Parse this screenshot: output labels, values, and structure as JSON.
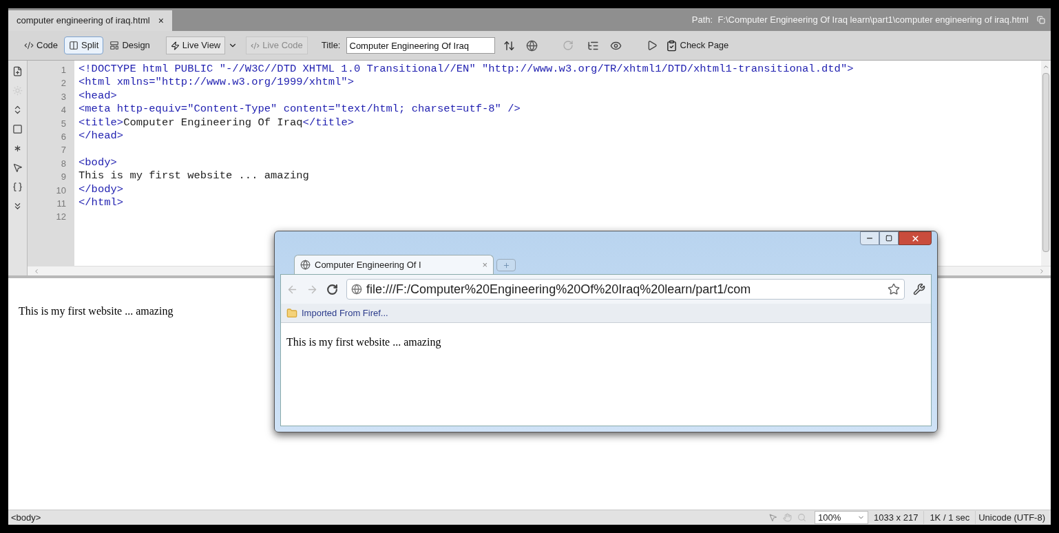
{
  "document_tab": {
    "label": "computer engineering of iraq.html",
    "close": "×"
  },
  "path": "Path:  F:\\Computer Engineering Of Iraq learn\\part1\\computer engineering of iraq.html",
  "toolbar": {
    "view_buttons": [
      {
        "label": "Code",
        "selected": false
      },
      {
        "label": "Split",
        "selected": true
      },
      {
        "label": "Design",
        "selected": false
      }
    ],
    "live_view": "Live View",
    "live_code": {
      "label": "Live Code",
      "disabled": true
    },
    "title_label": "Title:",
    "title_value": "Computer Engineering Of Iraq",
    "check_page": "Check Page"
  },
  "code": {
    "lines": [
      {
        "number": "1",
        "segments": [
          {
            "kind": "markup",
            "text": "<!DOCTYPE html PUBLIC \"-//W3C//DTD XHTML 1.0 Transitional//EN\" \"http://www.w3.org/TR/xhtml1/DTD/xhtml1-transitional.dtd\">"
          }
        ]
      },
      {
        "number": "2",
        "segments": [
          {
            "kind": "markup",
            "text": "<html xmlns=\"http://www.w3.org/1999/xhtml\">"
          }
        ]
      },
      {
        "number": "3",
        "segments": [
          {
            "kind": "markup",
            "text": "<head>"
          }
        ]
      },
      {
        "number": "4",
        "segments": [
          {
            "kind": "markup",
            "text": "<meta http-equiv=\"Content-Type\" content=\"text/html; charset=utf-8\" />"
          }
        ]
      },
      {
        "number": "5",
        "segments": [
          {
            "kind": "markup",
            "text": "<title>"
          },
          {
            "kind": "text",
            "text": "Computer Engineering Of Iraq"
          },
          {
            "kind": "markup",
            "text": "</title>"
          }
        ]
      },
      {
        "number": "6",
        "segments": [
          {
            "kind": "markup",
            "text": "</head>"
          }
        ]
      },
      {
        "number": "7"
      },
      {
        "number": "8",
        "segments": [
          {
            "kind": "markup",
            "text": "<body>"
          }
        ]
      },
      {
        "number": "9",
        "segments": [
          {
            "kind": "text",
            "text": "This is my first website ... amazing"
          }
        ]
      },
      {
        "number": "10",
        "segments": [
          {
            "kind": "markup",
            "text": "</body>"
          }
        ]
      },
      {
        "number": "11",
        "segments": [
          {
            "kind": "markup",
            "text": "</html>"
          }
        ]
      },
      {
        "number": "12"
      }
    ]
  },
  "design_view": {
    "text": "This is my first website ... amazing"
  },
  "status_bar": {
    "tag": "<body>",
    "zoom": "100%",
    "dimensions": "1033 x 217",
    "download": "1K / 1 sec",
    "encoding": "Unicode (UTF-8)"
  },
  "browser": {
    "tab_title": "Computer Engineering Of I",
    "tab_close": "×",
    "url": "file:///F:/Computer%20Engineering%20Of%20Iraq%20learn/part1/com",
    "bookmark": "Imported From Firef...",
    "content": "This is my first website ... amazing"
  }
}
